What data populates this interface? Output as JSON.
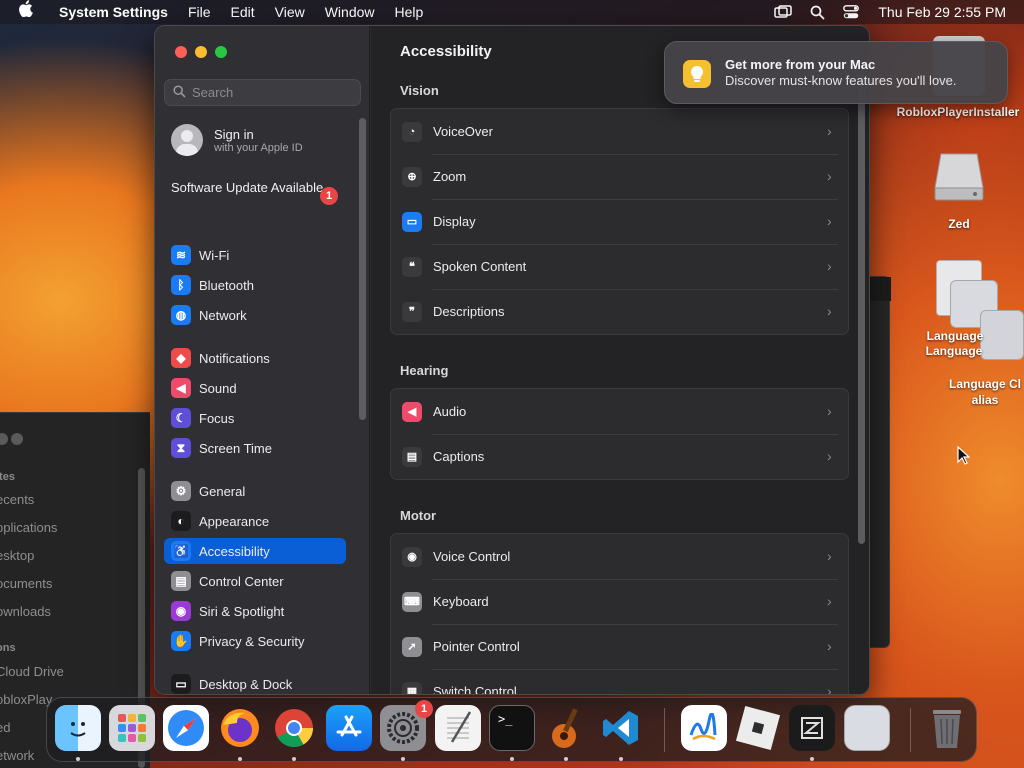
{
  "menubar": {
    "app_name": "System Settings",
    "items": [
      "File",
      "Edit",
      "View",
      "Window",
      "Help"
    ],
    "clock": "Thu Feb 29  2:55 PM"
  },
  "finder_bg": {
    "sections": [
      "ites",
      "ons"
    ],
    "items": [
      "ecents",
      "pplications",
      "esktop",
      "ocuments",
      "ownloads",
      "Cloud Drive",
      "obloxPlay",
      "ed",
      "etwork"
    ]
  },
  "settings": {
    "search_placeholder": "Search",
    "signin": {
      "title": "Sign in",
      "subtitle": "with your Apple ID"
    },
    "update": {
      "label": "Software Update Available",
      "count": "1"
    },
    "sidebar": [
      {
        "label": "Wi-Fi",
        "icon": "wifi-icon",
        "color": "#1a7cf4"
      },
      {
        "label": "Bluetooth",
        "icon": "bluetooth-icon",
        "color": "#1a7cf4"
      },
      {
        "label": "Network",
        "icon": "globe-icon",
        "color": "#1a7cf4"
      },
      {
        "label": "Notifications",
        "icon": "bell-icon",
        "color": "#ee4b4b"
      },
      {
        "label": "Sound",
        "icon": "speaker-icon",
        "color": "#ee4b6a"
      },
      {
        "label": "Focus",
        "icon": "moon-icon",
        "color": "#5d4fd8"
      },
      {
        "label": "Screen Time",
        "icon": "hourglass-icon",
        "color": "#5d4fd8"
      },
      {
        "label": "General",
        "icon": "gear-icon",
        "color": "#8e8e93"
      },
      {
        "label": "Appearance",
        "icon": "appearance-icon",
        "color": "#1c1c1e"
      },
      {
        "label": "Accessibility",
        "icon": "accessibility-icon",
        "color": "#1a7cf4"
      },
      {
        "label": "Control Center",
        "icon": "control-center-icon",
        "color": "#8e8e93"
      },
      {
        "label": "Siri & Spotlight",
        "icon": "siri-icon",
        "color": "#9a3bd6"
      },
      {
        "label": "Privacy & Security",
        "icon": "hand-icon",
        "color": "#1a7cf4"
      },
      {
        "label": "Desktop & Dock",
        "icon": "dock-icon",
        "color": "#1c1c1e"
      }
    ],
    "selected": "Accessibility",
    "page_title": "Accessibility",
    "sections": [
      {
        "title": "Vision",
        "rows": [
          {
            "label": "VoiceOver",
            "icon": "voiceover-icon",
            "color": "#3a3a3c"
          },
          {
            "label": "Zoom",
            "icon": "zoom-icon",
            "color": "#3a3a3c"
          },
          {
            "label": "Display",
            "icon": "display-icon",
            "color": "#1a7cf4"
          },
          {
            "label": "Spoken Content",
            "icon": "speech-bubble-icon",
            "color": "#3a3a3c"
          },
          {
            "label": "Descriptions",
            "icon": "descriptions-icon",
            "color": "#3a3a3c"
          }
        ]
      },
      {
        "title": "Hearing",
        "rows": [
          {
            "label": "Audio",
            "icon": "audio-icon",
            "color": "#ee4b6a"
          },
          {
            "label": "Captions",
            "icon": "captions-icon",
            "color": "#3a3a3c"
          }
        ]
      },
      {
        "title": "Motor",
        "rows": [
          {
            "label": "Voice Control",
            "icon": "voice-control-icon",
            "color": "#3a3a3c"
          },
          {
            "label": "Keyboard",
            "icon": "keyboard-icon",
            "color": "#8e8e93"
          },
          {
            "label": "Pointer Control",
            "icon": "pointer-icon",
            "color": "#8e8e93"
          },
          {
            "label": "Switch Control",
            "icon": "switch-control-icon",
            "color": "#3a3a3c"
          }
        ]
      }
    ]
  },
  "notification": {
    "title": "Get more from your Mac",
    "body": "Discover must-know features you'll love."
  },
  "desktop": {
    "roblox": "RobloxPlayerInstaller",
    "zed": "Zed",
    "lang1": "Language",
    "lang2": "Language",
    "lang3": "Language Cl alias"
  },
  "dock": {
    "apps": [
      "Finder",
      "Launchpad",
      "Safari",
      "Firefox",
      "Chrome",
      "App Store",
      "System Settings",
      "TextEdit",
      "Terminal",
      "GarageBand",
      "Visual Studio Code",
      "Freeform",
      "Roblox",
      "Zed",
      "Preview",
      "Trash"
    ],
    "settings_badge": "1"
  }
}
